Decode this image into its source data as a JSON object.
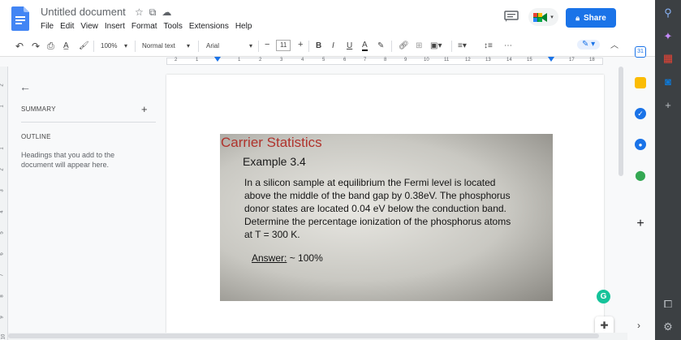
{
  "app": {
    "title": "Untitled document",
    "menus": [
      "File",
      "Edit",
      "View",
      "Insert",
      "Format",
      "Tools",
      "Extensions",
      "Help"
    ],
    "share_label": "Share",
    "colors": {
      "share": "#1a73e8",
      "accent_red": "#b0332c",
      "grammarly": "#15c39a"
    }
  },
  "toolbar": {
    "zoom": "100%",
    "style": "Normal text",
    "font": "Arial",
    "font_size": "11"
  },
  "ruler": {
    "numbers": [
      "2",
      "1",
      "1",
      "2",
      "3",
      "4",
      "5",
      "6",
      "7",
      "8",
      "9",
      "10",
      "11",
      "12",
      "13",
      "14",
      "15",
      "17",
      "18"
    ]
  },
  "vruler": {
    "numbers": [
      "2",
      "1",
      "1",
      "2",
      "3",
      "4",
      "5",
      "6",
      "7",
      "8",
      "9",
      "10"
    ]
  },
  "outline": {
    "summary_label": "SUMMARY",
    "outline_label": "OUTLINE",
    "hint": "Headings that you add to the document will appear here."
  },
  "photo": {
    "title": "Carrier Statistics",
    "example": "Example 3.4",
    "lines": [
      "In a silicon sample at equilibrium the Fermi level is located",
      "above the middle of the band gap by 0.38eV. The phosphorus",
      "donor states are located 0.04 eV below the conduction band.",
      "Determine the percentage ionization of the phosphorus atoms",
      "at T = 300 K."
    ],
    "answer_label": "Answer:",
    "answer_value": "~ 100%"
  },
  "grammarly_letter": "G"
}
